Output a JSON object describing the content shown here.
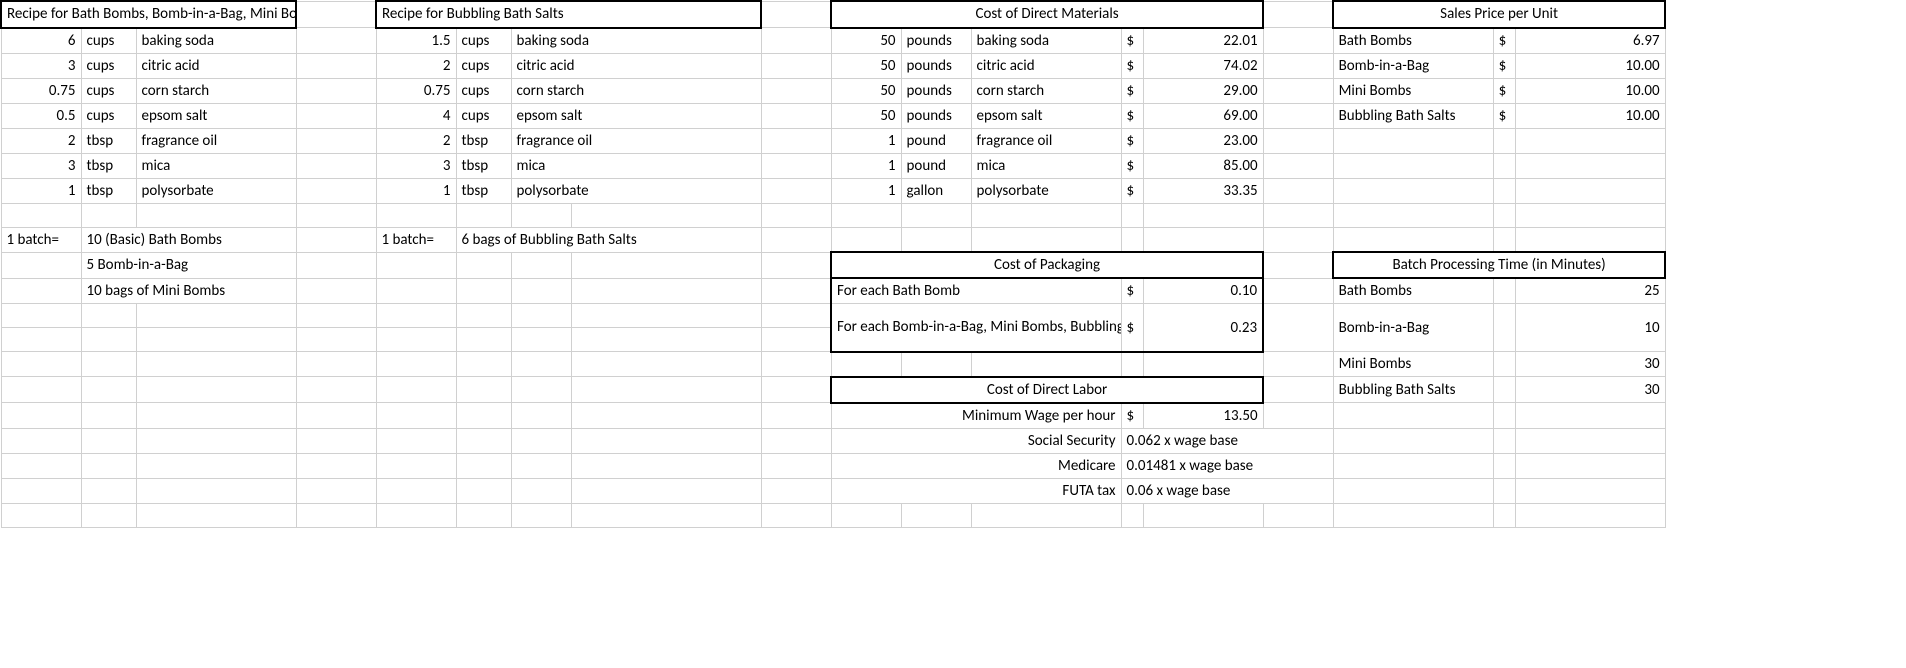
{
  "recipe1": {
    "title": "Recipe for Bath Bombs, Bomb-in-a-Bag, Mini Bombs",
    "rows": [
      {
        "qty": "6",
        "unit": "cups",
        "ing": "baking soda"
      },
      {
        "qty": "3",
        "unit": "cups",
        "ing": "citric acid"
      },
      {
        "qty": "0.75",
        "unit": "cups",
        "ing": "corn starch"
      },
      {
        "qty": "0.5",
        "unit": "cups",
        "ing": "epsom salt"
      },
      {
        "qty": "2",
        "unit": "tbsp",
        "ing": "fragrance oil"
      },
      {
        "qty": "3",
        "unit": "tbsp",
        "ing": "mica"
      },
      {
        "qty": "1",
        "unit": "tbsp",
        "ing": "polysorbate"
      }
    ],
    "batchLabel": "1 batch=",
    "yields": [
      "10 (Basic) Bath Bombs",
      "5 Bomb-in-a-Bag",
      "10 bags of Mini Bombs"
    ]
  },
  "recipe2": {
    "title": "Recipe for Bubbling Bath Salts",
    "rows": [
      {
        "qty": "1.5",
        "unit": "cups",
        "ing": "baking soda"
      },
      {
        "qty": "2",
        "unit": "cups",
        "ing": "citric acid"
      },
      {
        "qty": "0.75",
        "unit": "cups",
        "ing": "corn starch"
      },
      {
        "qty": "4",
        "unit": "cups",
        "ing": "epsom salt"
      },
      {
        "qty": "2",
        "unit": "tbsp",
        "ing": "fragrance oil"
      },
      {
        "qty": "3",
        "unit": "tbsp",
        "ing": "mica"
      },
      {
        "qty": "1",
        "unit": "tbsp",
        "ing": "polysorbate"
      }
    ],
    "batchLabel": "1 batch=",
    "yield": "6 bags of Bubbling Bath Salts"
  },
  "materials": {
    "title": "Cost of Direct Materials",
    "rows": [
      {
        "qty": "50",
        "unit": "pounds",
        "ing": "baking soda",
        "sym": "$",
        "cost": "22.01"
      },
      {
        "qty": "50",
        "unit": "pounds",
        "ing": "citric acid",
        "sym": "$",
        "cost": "74.02"
      },
      {
        "qty": "50",
        "unit": "pounds",
        "ing": "corn starch",
        "sym": "$",
        "cost": "29.00"
      },
      {
        "qty": "50",
        "unit": "pounds",
        "ing": "epsom salt",
        "sym": "$",
        "cost": "69.00"
      },
      {
        "qty": "1",
        "unit": "pound",
        "ing": "fragrance oil",
        "sym": "$",
        "cost": "23.00"
      },
      {
        "qty": "1",
        "unit": "pound",
        "ing": "mica",
        "sym": "$",
        "cost": "85.00"
      },
      {
        "qty": "1",
        "unit": "gallon",
        "ing": "polysorbate",
        "sym": "$",
        "cost": "33.35"
      }
    ]
  },
  "sales": {
    "title": "Sales Price per Unit",
    "rows": [
      {
        "name": "Bath Bombs",
        "sym": "$",
        "price": "6.97"
      },
      {
        "name": "Bomb-in-a-Bag",
        "sym": "$",
        "price": "10.00"
      },
      {
        "name": "Mini Bombs",
        "sym": "$",
        "price": "10.00"
      },
      {
        "name": "Bubbling Bath Salts",
        "sym": "$",
        "price": "10.00"
      }
    ]
  },
  "packaging": {
    "title": "Cost of Packaging",
    "rows": [
      {
        "desc": "For each Bath Bomb",
        "sym": "$",
        "cost": "0.10"
      },
      {
        "desc": "For each Bomb-in-a-Bag, Mini Bombs, Bubbling Bath Salts",
        "sym": "$",
        "cost": "0.23"
      }
    ]
  },
  "processing": {
    "title": "Batch Processing Time (in Minutes)",
    "rows": [
      {
        "name": "Bath Bombs",
        "min": "25"
      },
      {
        "name": "Bomb-in-a-Bag",
        "min": "10"
      },
      {
        "name": "Mini Bombs",
        "min": "30"
      },
      {
        "name": "Bubbling Bath Salts",
        "min": "30"
      }
    ]
  },
  "labor": {
    "title": "Cost of Direct Labor",
    "rows": [
      {
        "label": "Minimum Wage per hour",
        "sym": "$",
        "val": "13.50"
      },
      {
        "label": "Social Security",
        "val": "0.062 x wage base"
      },
      {
        "label": "Medicare",
        "val": "0.01481 x wage base"
      },
      {
        "label": "FUTA tax",
        "val": "0.06 x wage base"
      }
    ]
  }
}
